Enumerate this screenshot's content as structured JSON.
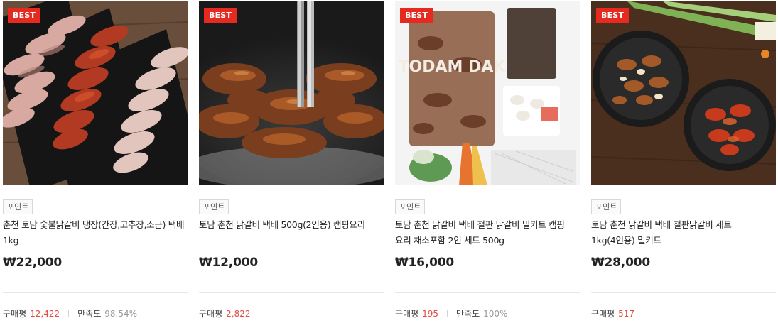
{
  "products": [
    {
      "badge": "BEST",
      "tag": "포인트",
      "title": "춘천 토담 숯불닭갈비 냉장(간장,고추장,소금) 택배 1kg",
      "price": "₩22,000",
      "review_label": "구매평",
      "review_count": "12,422",
      "satisfaction_label": "만족도",
      "satisfaction_value": "98.54%"
    },
    {
      "badge": "BEST",
      "tag": "포인트",
      "title": "토담 춘천 닭갈비 택배 500g(2인용) 캠핑요리",
      "price": "₩12,000",
      "review_label": "구매평",
      "review_count": "2,822"
    },
    {
      "badge": "BEST",
      "tag": "포인트",
      "title": "토담 춘천 닭갈비 택배 철판 닭갈비 밀키트 캠핑 요리 채소포함 2인 세트 500g",
      "price": "₩16,000",
      "review_label": "구매평",
      "review_count": "195",
      "satisfaction_label": "만족도",
      "satisfaction_value": "100%"
    },
    {
      "badge": "BEST",
      "tag": "포인트",
      "title": "토담 춘천 닭갈비 택배 철판닭갈비 세트 1kg(4인용) 밀키트",
      "price": "₩28,000",
      "review_label": "구매평",
      "review_count": "517"
    }
  ],
  "package_text": "TODAM DAK",
  "colors": {
    "badge": "#e72a1f",
    "review_count": "#e24c3f",
    "satisfaction": "#999999",
    "divider": "#e8e8e8"
  }
}
